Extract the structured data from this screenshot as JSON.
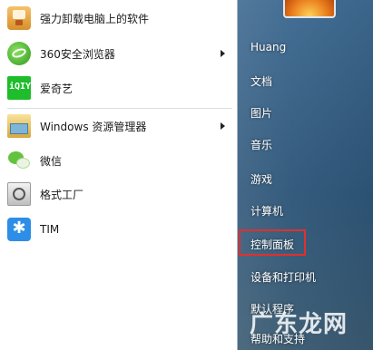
{
  "left_pane": {
    "apps": [
      {
        "label": "强力卸载电脑上的软件",
        "icon": "uninstall-icon",
        "has_submenu": false
      },
      {
        "label": "360安全浏览器",
        "icon": "360-browser-icon",
        "has_submenu": true
      },
      {
        "label": "爱奇艺",
        "icon": "iqiyi-icon",
        "has_submenu": false
      },
      {
        "label": "Windows 资源管理器",
        "icon": "explorer-icon",
        "has_submenu": true
      },
      {
        "label": "微信",
        "icon": "wechat-icon",
        "has_submenu": false
      },
      {
        "label": "格式工厂",
        "icon": "format-factory-icon",
        "has_submenu": false
      },
      {
        "label": "TIM",
        "icon": "tim-icon",
        "has_submenu": false
      }
    ],
    "iqiyi_logo_text": "iQIY",
    "tim_logo_text": "✱"
  },
  "right_pane": {
    "user_name": "Huang",
    "places": [
      "文档",
      "图片",
      "音乐",
      "游戏",
      "计算机",
      "控制面板",
      "设备和打印机",
      "默认程序",
      "帮助和支持"
    ],
    "highlighted": "控制面板",
    "highlight_color": "#e0302e"
  },
  "watermark": "广东龙网"
}
